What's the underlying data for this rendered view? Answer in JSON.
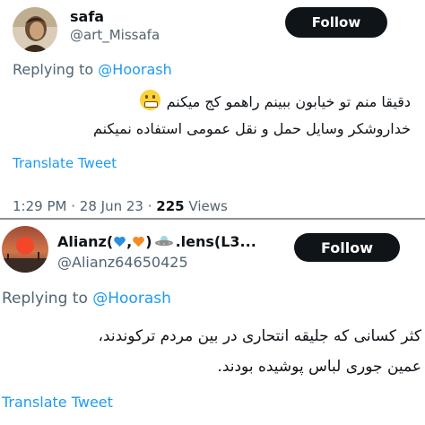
{
  "tweet1": {
    "name": "safa",
    "handle": "@art_Missafa",
    "follow_label": "Follow",
    "replying_prefix": "Replying to",
    "replying_handle": "@Hoorash",
    "line1": "دقیقا منم تو خیابون ببینم راهمو کج میکنم",
    "line2": "خداروشکر وسایل حمل و نقل عمومی استفاده نمیکنم",
    "translate_label": "Translate Tweet",
    "time": "1:29 PM",
    "date": "28 Jun 23",
    "views_count": "225",
    "views_label": "Views"
  },
  "tweet2": {
    "name_prefix": "Alianz(",
    "name_mid": ",",
    "name_close": ")",
    "name_suffix": ".lens(L3...",
    "handle": "@Alianz64650425",
    "follow_label": "Follow",
    "replying_prefix": "Replying to",
    "replying_handle": "@Hoorash",
    "line1": "کثر کسانی که جلیقه انتحاری در بین مردم ترکوندند،",
    "line2": "عمین جوری لباس پوشیده بودند.",
    "translate_label": "Translate Tweet"
  },
  "colors": {
    "accent": "#1d9bf0",
    "secondary_text": "#536471",
    "follow_bg": "#0f1419",
    "heart_blue": "#2b8fe0",
    "heart_orange": "#f58a1f"
  },
  "icons": {
    "tweet1_emoji": "grimacing-face-icon",
    "tweet2_name_emoji_1": "blue-heart-icon",
    "tweet2_name_emoji_2": "orange-heart-icon",
    "tweet2_name_emoji_3": "ufo-icon"
  }
}
